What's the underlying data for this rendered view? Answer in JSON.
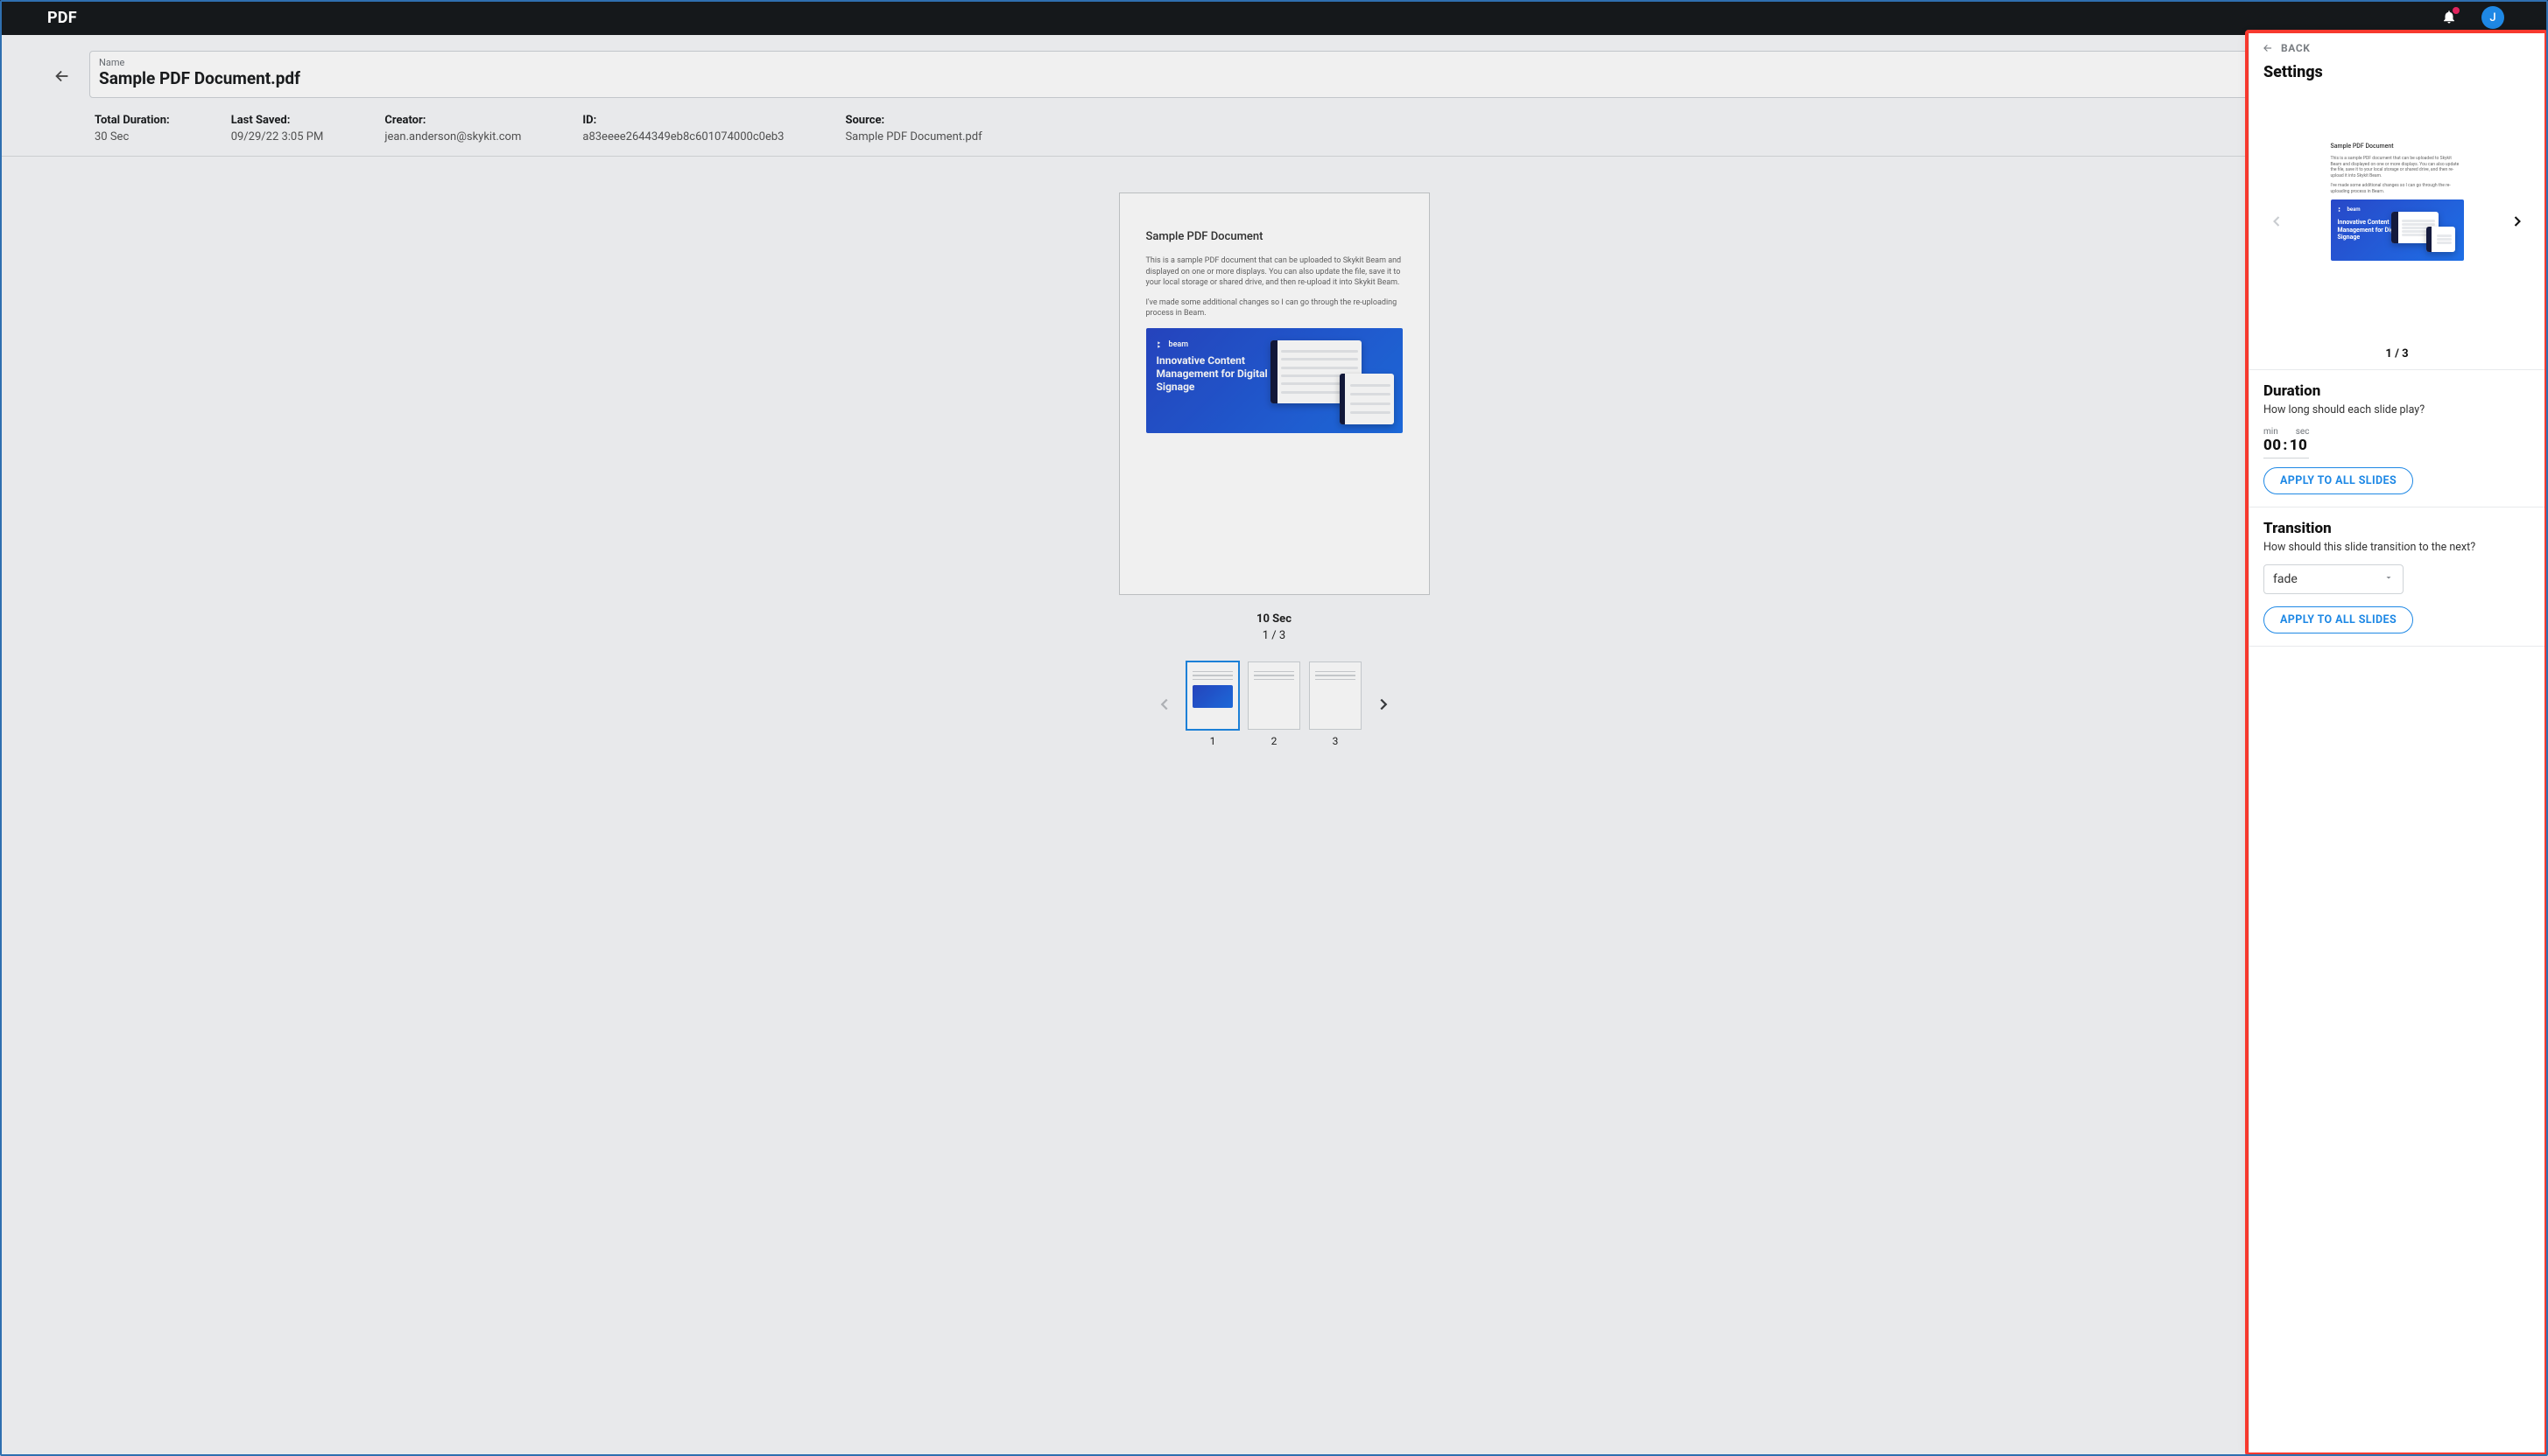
{
  "topbar": {
    "app_title": "PDF",
    "avatar_initial": "J"
  },
  "header": {
    "name_label": "Name",
    "name_value": "Sample PDF Document.pdf"
  },
  "meta": {
    "duration_label": "Total Duration:",
    "duration_value": "30 Sec",
    "saved_label": "Last Saved:",
    "saved_value": "09/29/22 3:05 PM",
    "creator_label": "Creator:",
    "creator_value": "jean.anderson@skykit.com",
    "id_label": "ID:",
    "id_value": "a83eeee2644349eb8c601074000c0eb3",
    "source_label": "Source:",
    "source_value": "Sample PDF Document.pdf"
  },
  "doc": {
    "title": "Sample PDF Document",
    "para1": "This is a sample PDF document that can be uploaded to Skykit Beam and displayed on one or more displays. You can also update the file, save it to your local storage or shared drive, and then re-upload it into Skykit Beam.",
    "para2": "I've made some additional changes so I can go through the re-uploading process in Beam.",
    "promo_brand": "beam",
    "promo_headline": "Innovative Content Management for Digital Signage"
  },
  "stage": {
    "caption": "10 Sec",
    "index": "1 / 3",
    "thumbs": [
      "1",
      "2",
      "3"
    ]
  },
  "panel": {
    "back_label": "BACK",
    "title": "Settings",
    "preview_index": "1 / 3",
    "duration": {
      "heading": "Duration",
      "sub": "How long should each slide play?",
      "min_label": "min",
      "sec_label": "sec",
      "min_value": "00",
      "sec_value": "10",
      "apply_label": "APPLY TO ALL SLIDES"
    },
    "transition": {
      "heading": "Transition",
      "sub": "How should this slide transition to the next?",
      "value": "fade",
      "apply_label": "APPLY TO ALL SLIDES"
    }
  }
}
